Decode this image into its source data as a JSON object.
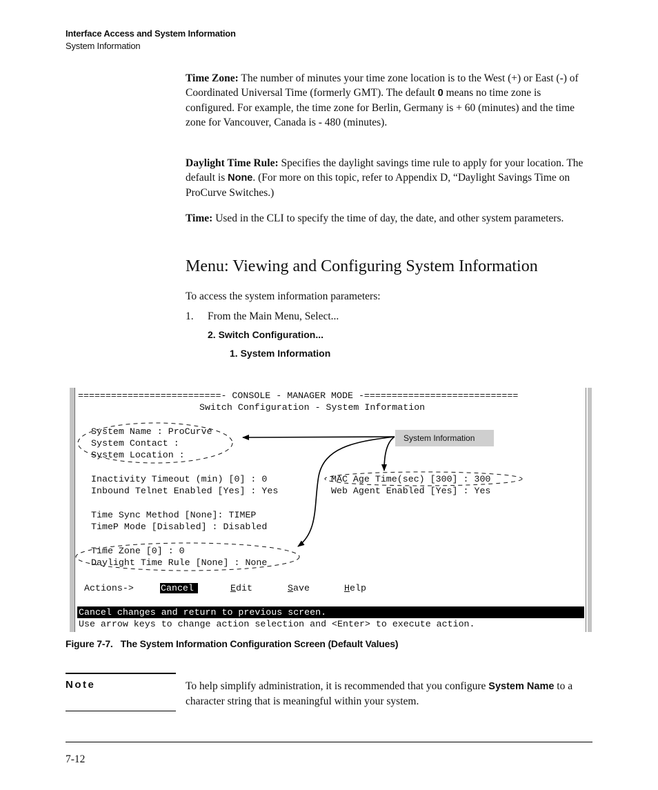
{
  "header": {
    "chapter": "Interface Access and System Information",
    "section": "System Information"
  },
  "definitions": [
    {
      "term": "Time Zone:",
      "text_before": " The number of minutes your time zone location is to the West (+) or East (-) of Coordinated Universal Time (formerly GMT). The default ",
      "bold_value": "0",
      "text_after": " means no time zone is configured. For example, the time zone for Berlin, Germany is + 60 (minutes) and the time zone for Vancouver, Canada is - 480 (minutes)."
    },
    {
      "term": "Daylight Time Rule:",
      "text_before": " Specifies the daylight savings time rule to apply for your location. The default is ",
      "bold_value": "None",
      "text_after": ". (For more on this topic, refer to Appendix D, “Daylight Savings Time on ProCurve Switches.)"
    },
    {
      "term": "Time:",
      "text_before": " Used in the CLI to specify the time of day, the date, and other system parameters.",
      "bold_value": "",
      "text_after": ""
    }
  ],
  "section_heading": "Menu: Viewing and Configuring System Information",
  "intro": "To access the system information parameters:",
  "steps": {
    "number": "1.",
    "text": "From the Main Menu, Select...",
    "sub1": "2. Switch Configuration...",
    "sub2": "1. System Information"
  },
  "terminal": {
    "title_line": "==========================- CONSOLE - MANAGER MODE -============================",
    "subtitle": "Switch Configuration - System Information",
    "fields_left": [
      {
        "label": "System Name : ",
        "value": "ProCurve"
      },
      {
        "label": "System Contact : ",
        "value": ""
      },
      {
        "label": "System Location : ",
        "value": ""
      },
      {
        "label": "Inactivity Timeout (min) [0] : ",
        "value": "0"
      },
      {
        "label": "Inbound Telnet Enabled [Yes] : ",
        "value": "Yes"
      },
      {
        "label": "Time Sync Method [None]: ",
        "value": "TIMEP"
      },
      {
        "label": "TimeP Mode [Disabled] : ",
        "value": "Disabled"
      },
      {
        "label": "Time Zone [0] : ",
        "value": "0"
      },
      {
        "label": "Daylight Time Rule [None] : ",
        "value": "None"
      }
    ],
    "fields_right": [
      {
        "label": "MAC Age Time(sec) [300] : ",
        "value": "300"
      },
      {
        "label": "Web Agent Enabled [Yes] : ",
        "value": "Yes"
      }
    ],
    "actions_label": "Actions->",
    "actions": [
      {
        "label": "Cancel",
        "hotkey": "",
        "rest": "",
        "selected": true
      },
      {
        "label": "Edit",
        "hotkey": "E",
        "rest": "dit",
        "selected": false
      },
      {
        "label": "Save",
        "hotkey": "S",
        "rest": "ave",
        "selected": false
      },
      {
        "label": "Help",
        "hotkey": "H",
        "rest": "elp",
        "selected": false
      }
    ],
    "status_message": "Cancel changes and return to previous screen.",
    "help_message": "Use arrow keys to change action selection and <Enter> to execute action."
  },
  "callout": {
    "label": "System Information",
    "color": "#cfcfcf"
  },
  "figure_caption": "Figure 7-7.   The System Information Configuration Screen (Default Values)",
  "note": {
    "label": "Note",
    "text_before": "To help simplify administration, it is recommended that you configure ",
    "bold": "System Name",
    "text_after": " to a character string that is meaningful within your system."
  },
  "footer": {
    "page_number": "7-12"
  }
}
